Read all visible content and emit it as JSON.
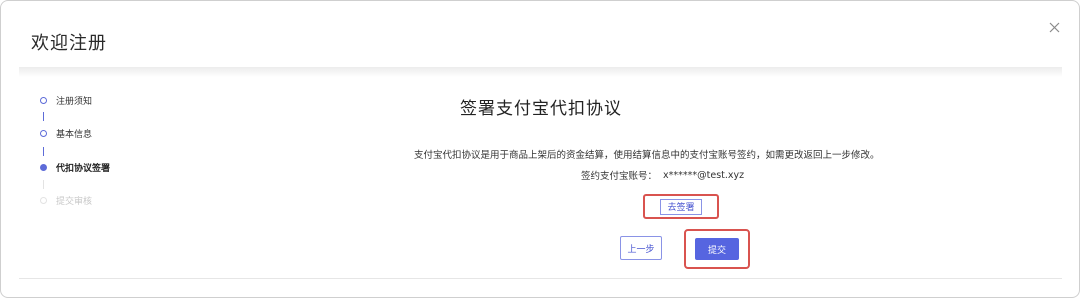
{
  "dialog": {
    "title": "欢迎注册",
    "close_icon": "close-icon"
  },
  "steps": [
    {
      "label": "注册须知",
      "state": "done"
    },
    {
      "label": "基本信息",
      "state": "done"
    },
    {
      "label": "代扣协议签署",
      "state": "active"
    },
    {
      "label": "提交审核",
      "state": "pending"
    }
  ],
  "content": {
    "heading": "签署支付宝代扣协议",
    "description": "支付宝代扣协议是用于商品上架后的资金结算，使用结算信息中的支付宝账号签约，如需更改返回上一步修改。",
    "account_label": "签约支付宝账号：",
    "account_value": "x******@test.xyz",
    "sign_button": "去签署",
    "prev_button": "上一步",
    "submit_button": "提交"
  },
  "colors": {
    "accent": "#5665e0",
    "highlight": "#d9534f"
  }
}
